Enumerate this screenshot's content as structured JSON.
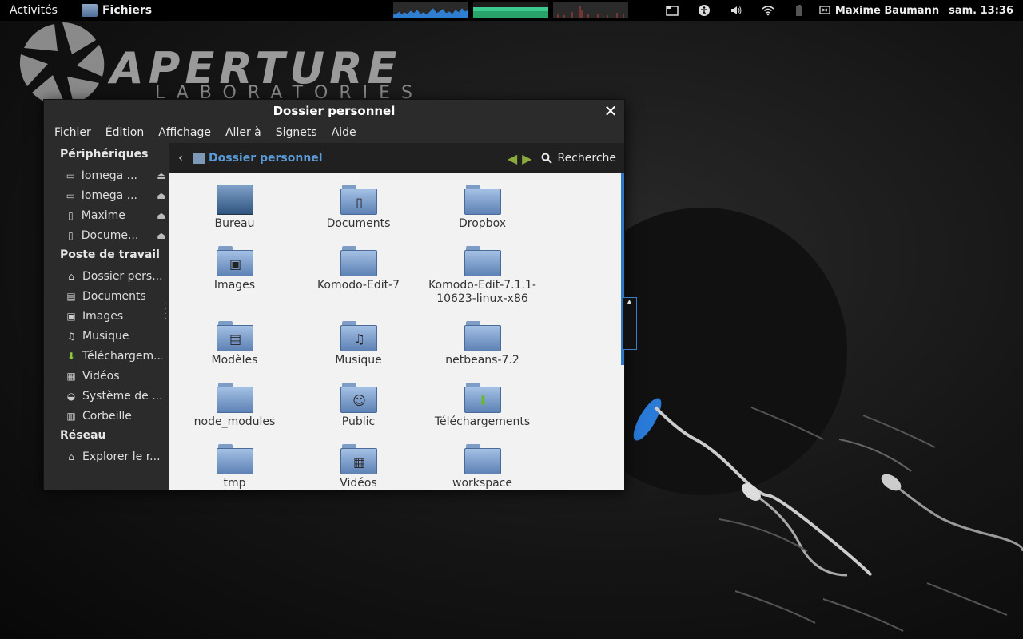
{
  "top_panel": {
    "activities": "Activités",
    "app_name": "Fichiers",
    "user": "Maxime Baumann",
    "clock": "sam. 13:36",
    "tray_icons": [
      "folder-icon",
      "accessibility-icon",
      "volume-icon",
      "wifi-icon",
      "battery-icon"
    ]
  },
  "wallpaper": {
    "logo_word": "APERTURE",
    "logo_sub": "LABORATORIES"
  },
  "window": {
    "title": "Dossier personnel",
    "menu": [
      "Fichier",
      "Édition",
      "Affichage",
      "Aller à",
      "Signets",
      "Aide"
    ]
  },
  "sidebar": {
    "sections": [
      {
        "heading": "Périphériques",
        "items": [
          {
            "label": "Iomega ...",
            "icon": "drive-icon",
            "eject": true
          },
          {
            "label": "Iomega ...",
            "icon": "drive-icon",
            "eject": true
          },
          {
            "label": "Maxime",
            "icon": "phone-icon",
            "eject": true
          },
          {
            "label": "Docume...",
            "icon": "phone-icon",
            "eject": true
          }
        ]
      },
      {
        "heading": "Poste de travail",
        "items": [
          {
            "label": "Dossier pers...",
            "icon": "home-icon"
          },
          {
            "label": "Documents",
            "icon": "document-icon"
          },
          {
            "label": "Images",
            "icon": "images-icon"
          },
          {
            "label": "Musique",
            "icon": "music-icon"
          },
          {
            "label": "Téléchargem...",
            "icon": "download-icon"
          },
          {
            "label": "Vidéos",
            "icon": "video-icon"
          },
          {
            "label": "Système de ...",
            "icon": "disk-icon"
          },
          {
            "label": "Corbeille",
            "icon": "trash-icon"
          }
        ]
      },
      {
        "heading": "Réseau",
        "items": [
          {
            "label": "Explorer le r...",
            "icon": "network-icon"
          }
        ]
      }
    ]
  },
  "pathbar": {
    "crumb": "Dossier personnel",
    "search": "Recherche"
  },
  "files": [
    {
      "name": "Bureau",
      "icon": "desktop-folder-icon"
    },
    {
      "name": "Documents",
      "icon": "documents-folder-icon"
    },
    {
      "name": "Dropbox",
      "icon": "folder-icon"
    },
    {
      "name": "Images",
      "icon": "images-folder-icon"
    },
    {
      "name": "Komodo-Edit-7",
      "icon": "folder-icon"
    },
    {
      "name": "Komodo-Edit-7.1.1-10623-linux-x86",
      "icon": "folder-icon"
    },
    {
      "name": "Modèles",
      "icon": "templates-folder-icon"
    },
    {
      "name": "Musique",
      "icon": "music-folder-icon"
    },
    {
      "name": "netbeans-7.2",
      "icon": "folder-icon"
    },
    {
      "name": "node_modules",
      "icon": "folder-icon"
    },
    {
      "name": "Public",
      "icon": "public-folder-icon"
    },
    {
      "name": "Téléchargements",
      "icon": "download-folder-icon"
    },
    {
      "name": "tmp",
      "icon": "folder-icon"
    },
    {
      "name": "Vidéos",
      "icon": "videos-folder-icon"
    },
    {
      "name": "workspace",
      "icon": "folder-icon"
    }
  ]
}
